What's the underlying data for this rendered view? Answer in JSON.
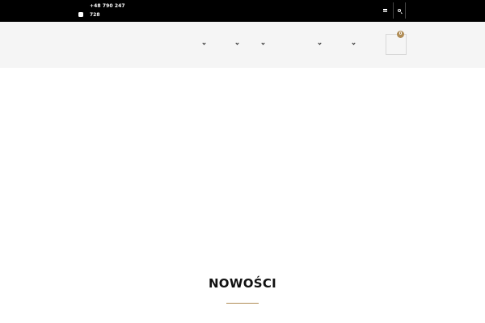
{
  "topbar": {
    "phone_line1": "+48 790 247",
    "phone_line2": "728",
    "icons": [
      "phone-icon",
      "hamburger-icon",
      "search-icon"
    ]
  },
  "nav": {
    "dropdown_icon": "chevron-down-icon",
    "dropdown_count": 5
  },
  "cart": {
    "count": "0",
    "icon": "cart-icon"
  },
  "main": {
    "section_title": "NOWOŚCI"
  },
  "colors": {
    "topbar_bg": "#000000",
    "header_bg": "#f5f5f5",
    "accent": "#b08d57",
    "text": "#111111"
  }
}
